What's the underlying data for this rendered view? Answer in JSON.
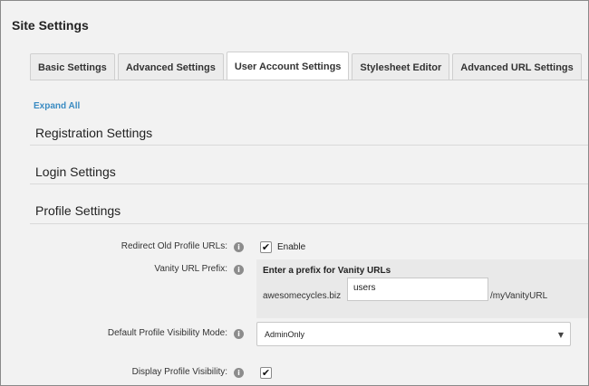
{
  "page": {
    "title": "Site Settings"
  },
  "tabs": [
    {
      "label": "Basic Settings",
      "active": false
    },
    {
      "label": "Advanced Settings",
      "active": false
    },
    {
      "label": "User Account Settings",
      "active": true
    },
    {
      "label": "Stylesheet Editor",
      "active": false
    },
    {
      "label": "Advanced URL Settings",
      "active": false
    }
  ],
  "expand_all": "Expand All",
  "sections": {
    "registration": "Registration Settings",
    "login": "Login Settings",
    "profile": "Profile Settings"
  },
  "profile": {
    "redirect_label": "Redirect Old Profile URLs:",
    "redirect_checked": true,
    "redirect_enable": "Enable",
    "vanity_label": "Vanity URL Prefix:",
    "vanity_title": "Enter a prefix for Vanity URLs",
    "vanity_domain": "awesomecycles.biz",
    "vanity_value": "users",
    "vanity_suffix": "/myVanityURL",
    "visibility_label": "Default Profile Visibility Mode:",
    "visibility_value": "AdminOnly",
    "display_label": "Display Profile Visibility:",
    "display_checked": true
  },
  "icons": {
    "info": "info-icon",
    "check": "checkmark-icon",
    "caret": "caret-down-icon"
  },
  "colors": {
    "background": "#f2f2f2",
    "link": "#3a8bc2",
    "active_tab": "#ffffff",
    "inactive_tab": "#ececec"
  }
}
